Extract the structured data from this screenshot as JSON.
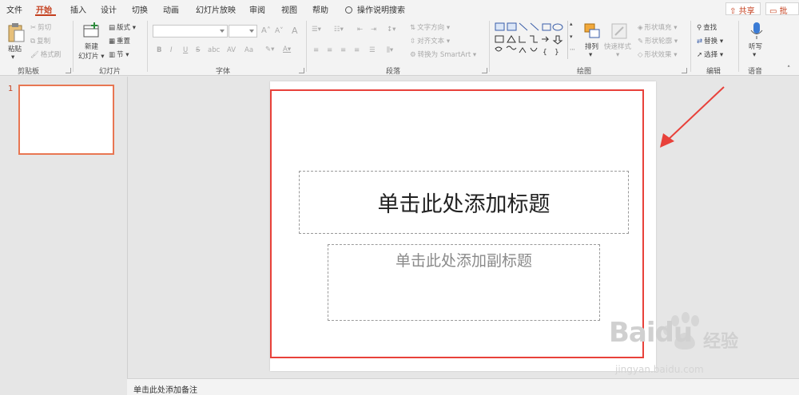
{
  "menu_tabs": [
    "文件",
    "开始",
    "插入",
    "设计",
    "切换",
    "动画",
    "幻灯片放映",
    "审阅",
    "视图",
    "帮助"
  ],
  "active_tab": "开始",
  "tell_me": "操作说明搜索",
  "share_label": "共享",
  "comment_label": "批注",
  "ribbon": {
    "clipboard": {
      "paste": "粘贴",
      "cut": "剪切",
      "copy": "复制",
      "format_painter": "格式刷",
      "label": "剪贴板"
    },
    "slides": {
      "new_slide": "新建",
      "new_slide_sub": "幻灯片",
      "layout": "版式",
      "reset": "重置",
      "section": "节",
      "label": "幻灯片"
    },
    "font": {
      "bold": "B",
      "italic": "I",
      "underline": "U",
      "strike": "S",
      "shadow": "abc",
      "grow": "A",
      "shrink": "A",
      "clear": "A",
      "spacing": "AV",
      "case": "Aa",
      "label": "字体"
    },
    "paragraph": {
      "text_direction": "文字方向",
      "align_text": "对齐文本",
      "smartart": "转换为 SmartArt",
      "label": "段落"
    },
    "drawing": {
      "arrange": "排列",
      "quick_styles": "快速样式",
      "shape_fill": "形状填充",
      "shape_outline": "形状轮廓",
      "shape_effects": "形状效果",
      "label": "绘图"
    },
    "editing": {
      "find": "查找",
      "replace": "替换",
      "select": "选择",
      "label": "编辑"
    },
    "voice": {
      "dictate": "听写",
      "label": "语音"
    }
  },
  "thumbnail": {
    "number": "1"
  },
  "slide": {
    "title_placeholder": "单击此处添加标题",
    "subtitle_placeholder": "单击此处添加副标题"
  },
  "notes_placeholder": "单击此处添加备注",
  "watermark": {
    "brand": "Bai",
    "brand2": "du",
    "suffix": "经验",
    "url": "jingyan.baidu.com"
  },
  "colors": {
    "accent": "#c43e1c",
    "highlight_box": "#e8413a",
    "thumb_border": "#e87652"
  }
}
